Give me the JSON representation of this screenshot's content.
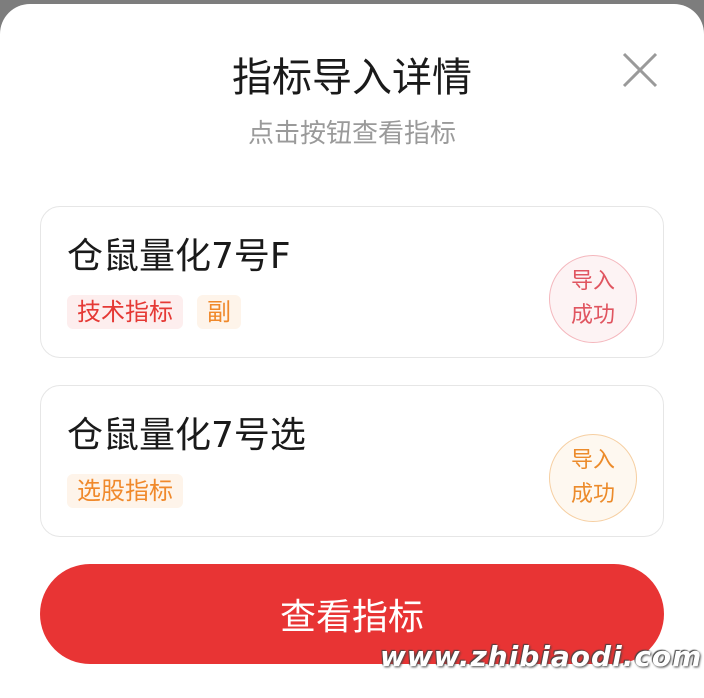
{
  "dialog": {
    "title": "指标导入详情",
    "subtitle": "点击按钮查看指标",
    "close_icon": "close-icon"
  },
  "cards": [
    {
      "name": "仓鼠量化7号F",
      "tags": [
        "技术指标",
        "副"
      ],
      "status_line1": "导入",
      "status_line2": "成功",
      "status_color": "#e05560"
    },
    {
      "name": "仓鼠量化7号选",
      "tags": [
        "选股指标"
      ],
      "status_line1": "导入",
      "status_line2": "成功",
      "status_color": "#ec8b2b"
    }
  ],
  "action": {
    "view_label": "查看指标",
    "color": "#e83434"
  },
  "watermark": "www.zhibiaodi.com"
}
